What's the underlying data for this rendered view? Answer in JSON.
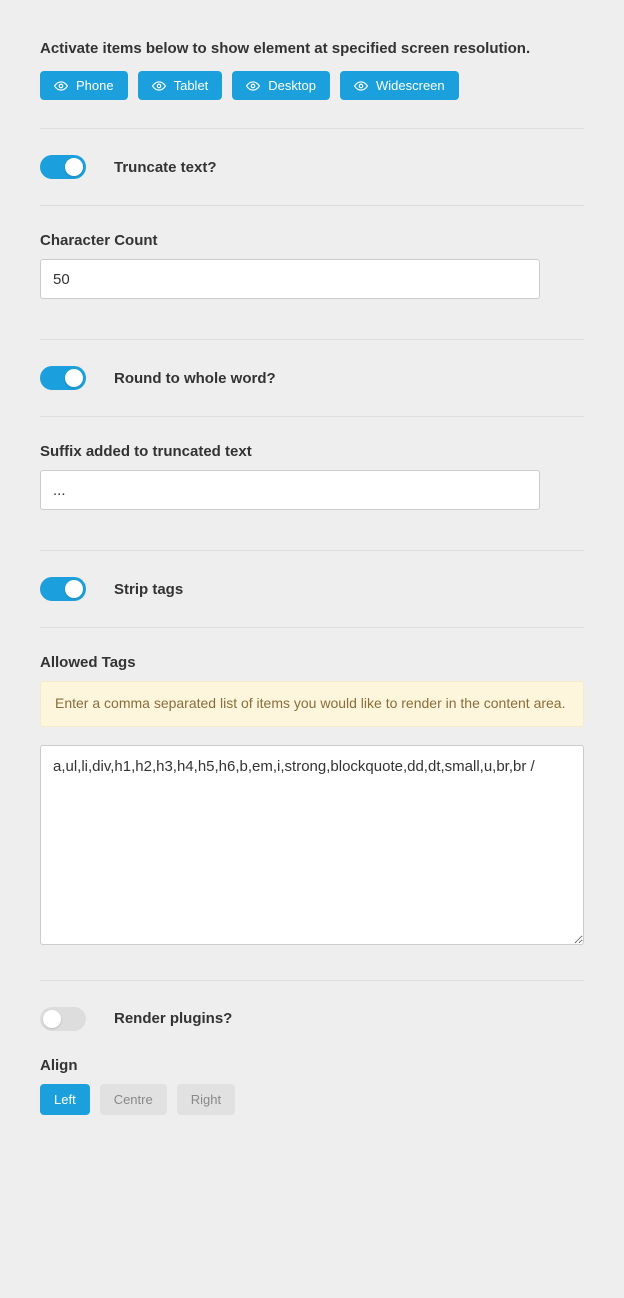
{
  "intro": "Activate items below to show element at specified screen resolution.",
  "devices": [
    {
      "label": "Phone"
    },
    {
      "label": "Tablet"
    },
    {
      "label": "Desktop"
    },
    {
      "label": "Widescreen"
    }
  ],
  "truncate": {
    "label": "Truncate text?",
    "enabled": true
  },
  "character_count": {
    "label": "Character Count",
    "value": "50"
  },
  "round_word": {
    "label": "Round to whole word?",
    "enabled": true
  },
  "suffix": {
    "label": "Suffix added to truncated text",
    "value": "..."
  },
  "strip_tags": {
    "label": "Strip tags",
    "enabled": true
  },
  "allowed_tags": {
    "label": "Allowed Tags",
    "hint": "Enter a comma separated list of items you would like to render in the content area.",
    "value": "a,ul,li,div,h1,h2,h3,h4,h5,h6,b,em,i,strong,blockquote,dd,dt,small,u,br,br /"
  },
  "render_plugins": {
    "label": "Render plugins?",
    "enabled": false
  },
  "align": {
    "label": "Align",
    "options": [
      "Left",
      "Centre",
      "Right"
    ],
    "selected": "Left"
  }
}
